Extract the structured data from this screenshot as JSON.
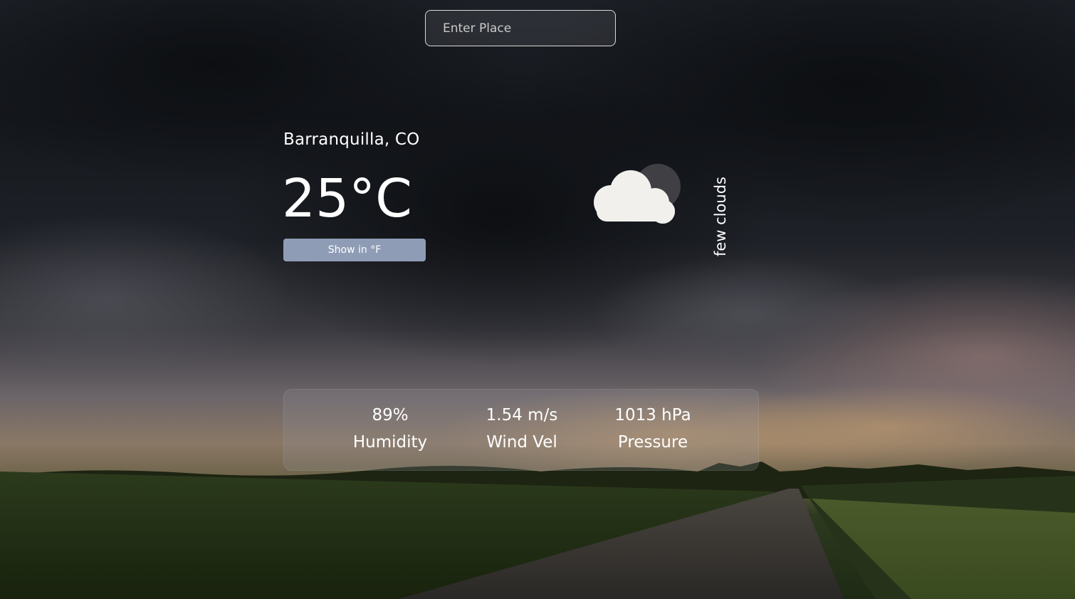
{
  "search": {
    "placeholder": "Enter Place",
    "value": ""
  },
  "weather": {
    "location": "Barranquilla, CO",
    "temperature": "25°C",
    "unit_toggle_label": "Show in °F",
    "condition": "few clouds",
    "icon": "cloud-moon-icon"
  },
  "stats": [
    {
      "value": "89%",
      "label": "Humidity"
    },
    {
      "value": "1.54 m/s",
      "label": "Wind Vel"
    },
    {
      "value": "1013 hPa",
      "label": "Pressure"
    }
  ],
  "colors": {
    "button_bg": "#8f9cb5",
    "text": "#ffffff"
  }
}
